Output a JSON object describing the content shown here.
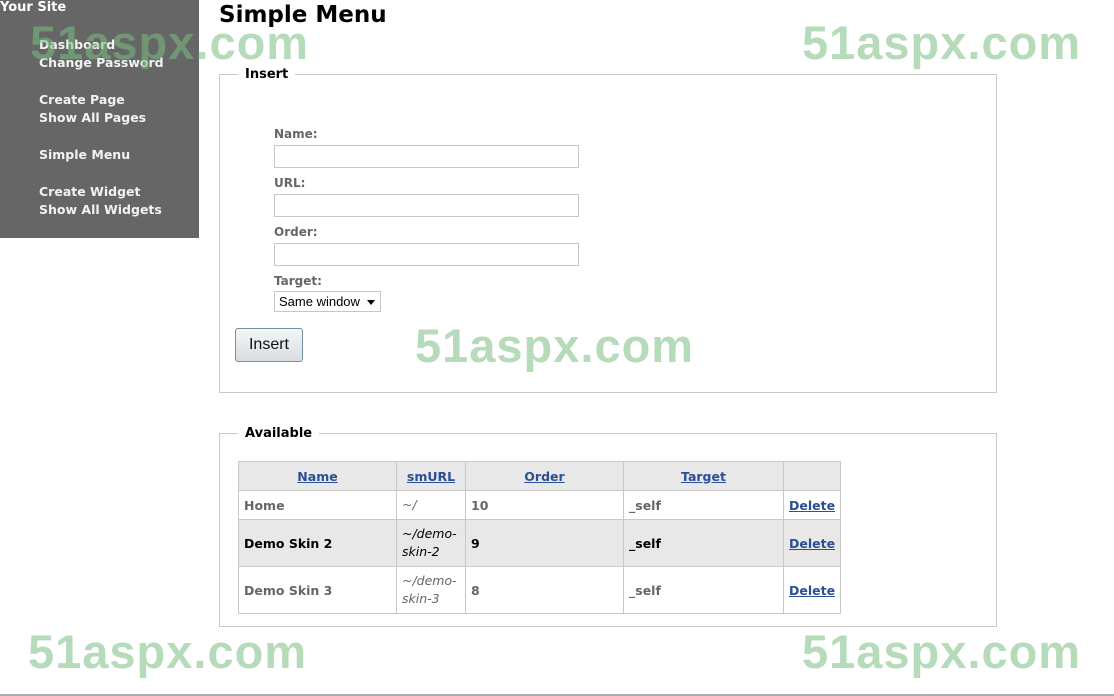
{
  "sidebar": {
    "site_title": "Your Site",
    "groups": [
      [
        "Dashboard",
        "Change Password"
      ],
      [
        "Create Page",
        "Show All Pages"
      ],
      [
        "Simple Menu"
      ],
      [
        "Create Widget",
        "Show All Widgets"
      ]
    ]
  },
  "page": {
    "title": "Simple Menu"
  },
  "insert_form": {
    "legend": "Insert",
    "name_label": "Name:",
    "name_value": "",
    "url_label": "URL:",
    "url_value": "",
    "order_label": "Order:",
    "order_value": "",
    "target_label": "Target:",
    "target_selected": "Same window",
    "insert_button": "Insert"
  },
  "available": {
    "legend": "Available",
    "columns": [
      "Name",
      "smURL",
      "Order",
      "Target",
      ""
    ],
    "rows": [
      {
        "name": "Home",
        "url": "~/",
        "order": "10",
        "target": "_self",
        "action": "Delete"
      },
      {
        "name": "Demo Skin 2",
        "url": "~/demo-skin-2",
        "order": "9",
        "target": "_self",
        "action": "Delete"
      },
      {
        "name": "Demo Skin 3",
        "url": "~/demo-skin-3",
        "order": "8",
        "target": "_self",
        "action": "Delete"
      }
    ]
  },
  "watermark": {
    "text": "51aspx.com",
    "color": "#78be82"
  },
  "colors": {
    "sidebar_bg": "#666666",
    "link": "#2a4f96",
    "header_bg": "#e8e8e8"
  }
}
